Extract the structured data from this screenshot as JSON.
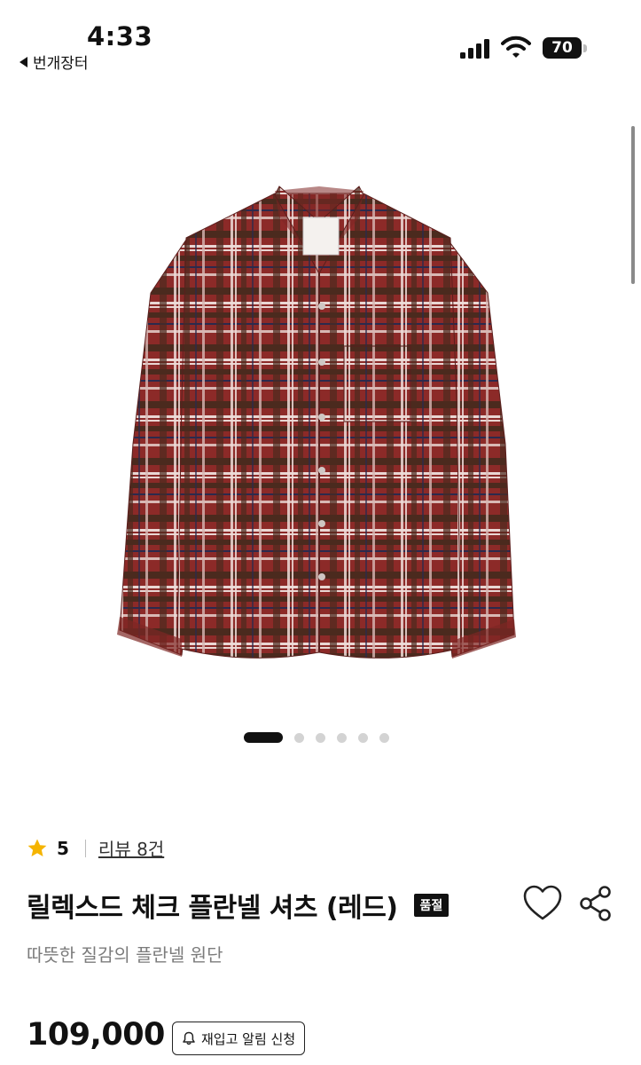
{
  "status_bar": {
    "time": "4:33",
    "back_app": "번개장터",
    "battery": "70",
    "icons": [
      "signal-icon",
      "wifi-icon",
      "battery-icon"
    ]
  },
  "gallery": {
    "image_subject": "red plaid flannel long-sleeve shirt",
    "slide_count": 6,
    "active_slide": 1
  },
  "product": {
    "rating": "5",
    "review_link": "리뷰 8건",
    "title": "릴렉스드 체크 플란넬 셔츠 (레드)",
    "badge": "품절",
    "subtitle": "따뜻한 질감의 플란넬 원단",
    "price": "109,000",
    "restock_button": "재입고 알림 신청"
  },
  "colors": {
    "accent_star": "#f5b400",
    "text_primary": "#111111",
    "text_secondary": "#7c7c7c"
  }
}
